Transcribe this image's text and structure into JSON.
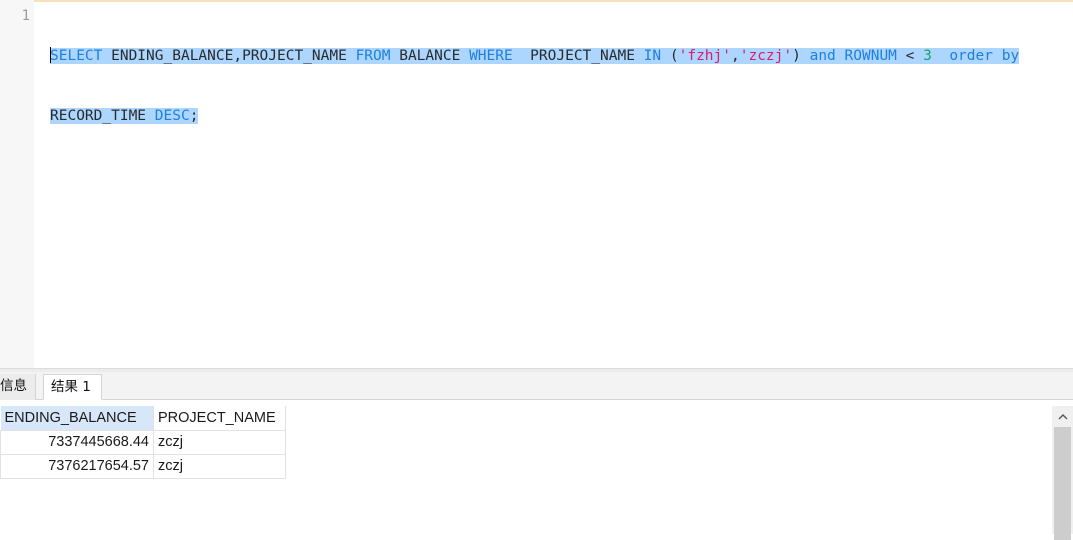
{
  "editor": {
    "line_number": "1",
    "line1": {
      "t1": "SELECT",
      "t2": " ENDING_BALANCE,PROJECT_NAME ",
      "t3": "FROM",
      "t4": " BALANCE ",
      "t5": "WHERE",
      "t6": "  PROJECT_NAME ",
      "t7": "IN",
      "t8": " (",
      "t9": "'fzhj'",
      "t10": ",",
      "t11": "'zczj'",
      "t12": ") ",
      "t13": "and",
      "t14": " ",
      "t15": "ROWNUM",
      "t16": " < ",
      "t17": "3",
      "t18": "  ",
      "t19": "order",
      "t20": " ",
      "t21": "by"
    },
    "line2": {
      "t1": "RECORD_TIME ",
      "t2": "DESC",
      "t3": ";"
    }
  },
  "tabs": {
    "info": "信息",
    "result": "结果 1"
  },
  "grid": {
    "columns": [
      "ENDING_BALANCE",
      "PROJECT_NAME"
    ],
    "rows": [
      [
        "7337445668.44",
        "zczj"
      ],
      [
        "7376217654.57",
        "zczj"
      ]
    ]
  },
  "colors": {
    "keyword": "#1d7fe0",
    "string": "#e01a66",
    "number": "#1aa36a",
    "selection": "#add6ff"
  },
  "icons": {
    "scroll_up": "chevron-up-icon"
  }
}
